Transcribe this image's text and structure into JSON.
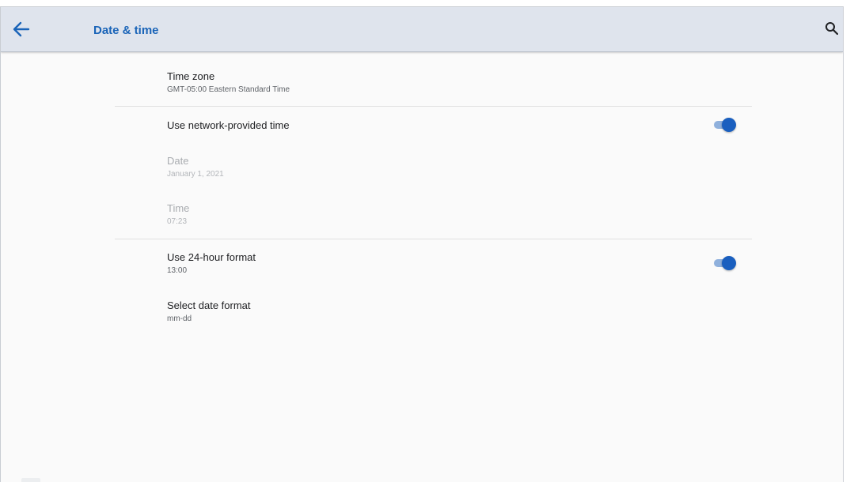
{
  "header": {
    "title": "Date & time",
    "back_icon": "arrow-left-icon",
    "search_icon": "search-icon",
    "title_color": "#1a64b8",
    "bar_color": "#dfe4ed"
  },
  "settings": {
    "time_zone": {
      "title": "Time zone",
      "summary": "GMT-05:00 Eastern Standard Time"
    },
    "network_time": {
      "title": "Use network-provided time",
      "enabled": true
    },
    "date": {
      "title": "Date",
      "summary": "January 1, 2021",
      "disabled": true
    },
    "time": {
      "title": "Time",
      "summary": "07:23",
      "disabled": true
    },
    "hour_format": {
      "title": "Use 24-hour format",
      "summary": "13:00",
      "enabled": true
    },
    "date_format": {
      "title": "Select date format",
      "summary": "mm-dd"
    }
  },
  "toggle_colors": {
    "track": "#8fb0dc",
    "thumb": "#1a5fbf"
  }
}
